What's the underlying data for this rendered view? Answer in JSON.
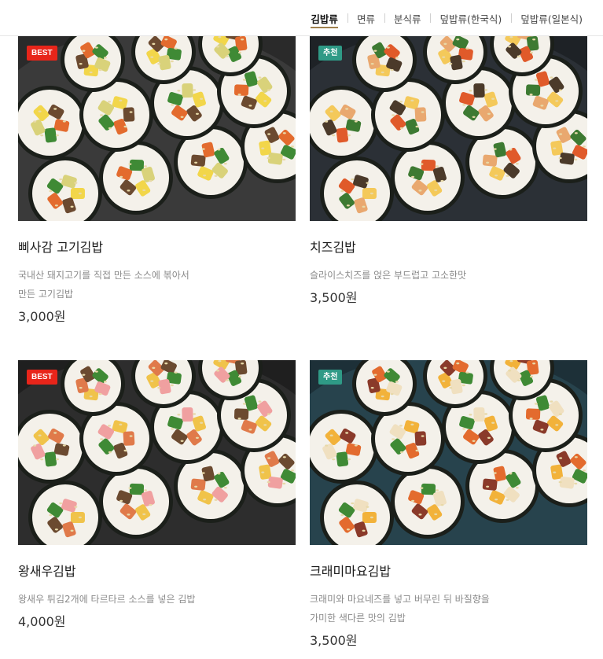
{
  "nav": {
    "tabs": [
      {
        "label": "김밥류",
        "active": true
      },
      {
        "label": "면류",
        "active": false
      },
      {
        "label": "분식류",
        "active": false
      },
      {
        "label": "덮밥류(한국식)",
        "active": false
      },
      {
        "label": "덮밥류(일본식)",
        "active": false
      }
    ]
  },
  "menu": [
    {
      "badge": "BEST",
      "badge_type": "best",
      "name": "삐사감 고기김밥",
      "desc": "국내산 돼지고기를 직접 만든 소스에 볶아서 만든 고기김밥",
      "price": "3,000원",
      "filling": "beef"
    },
    {
      "badge": "추천",
      "badge_type": "rec",
      "name": "치즈김밥",
      "desc": "슬라이스치즈를 얹은 부드럽고 고소한맛",
      "price": "3,500원",
      "filling": "cheese"
    },
    {
      "badge": "BEST",
      "badge_type": "best",
      "name": "왕새우김밥",
      "desc": "왕새우 튀김2개에 타르타르 소스를 넣은 김밥",
      "price": "4,000원",
      "filling": "shrimp"
    },
    {
      "badge": "추천",
      "badge_type": "rec",
      "name": "크래미마요김밥",
      "desc": "크래미와 마요네즈를 넣고 버무린 뒤 바질향을 가미한 색다른 맛의 김밥",
      "price": "3,500원",
      "filling": "crab"
    }
  ],
  "colors": {
    "accent": "#a0824e",
    "badge_best": "#e8251a",
    "badge_rec": "#2f9a86"
  }
}
